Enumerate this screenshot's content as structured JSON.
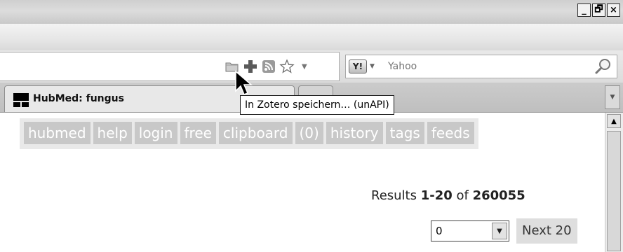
{
  "window": {
    "controls": {
      "minimize": "_",
      "maximize": "🗗",
      "close": "×"
    }
  },
  "navbar": {
    "url_icons": [
      "folder-icon",
      "plus-icon",
      "rss-feed-icon",
      "bookmark-star-icon",
      "chevron-down-icon"
    ],
    "search": {
      "engine_logo": "Y!",
      "placeholder": "Yahoo",
      "go_icon": "magnifier-icon"
    }
  },
  "tabs": {
    "active": {
      "title": "HubMed: fungus",
      "favicon": "hubmed-favicon"
    }
  },
  "tooltip": {
    "text": "In Zotero speichern… (unAPI)"
  },
  "content": {
    "nav": [
      "hubmed",
      "help",
      "login",
      "free",
      "clipboard",
      "(0)",
      "history",
      "tags",
      "feeds"
    ],
    "results": {
      "prefix": "Results ",
      "range": "1-20",
      "middle": " of ",
      "total": "260055"
    },
    "pager": {
      "page_value": "0",
      "next_label": "Next 20"
    }
  },
  "colors": {
    "nav_button_bg": "#c8c8c8",
    "nav_strip_bg": "#e9e9e9",
    "tooltip_border": "#1a1a1a"
  }
}
